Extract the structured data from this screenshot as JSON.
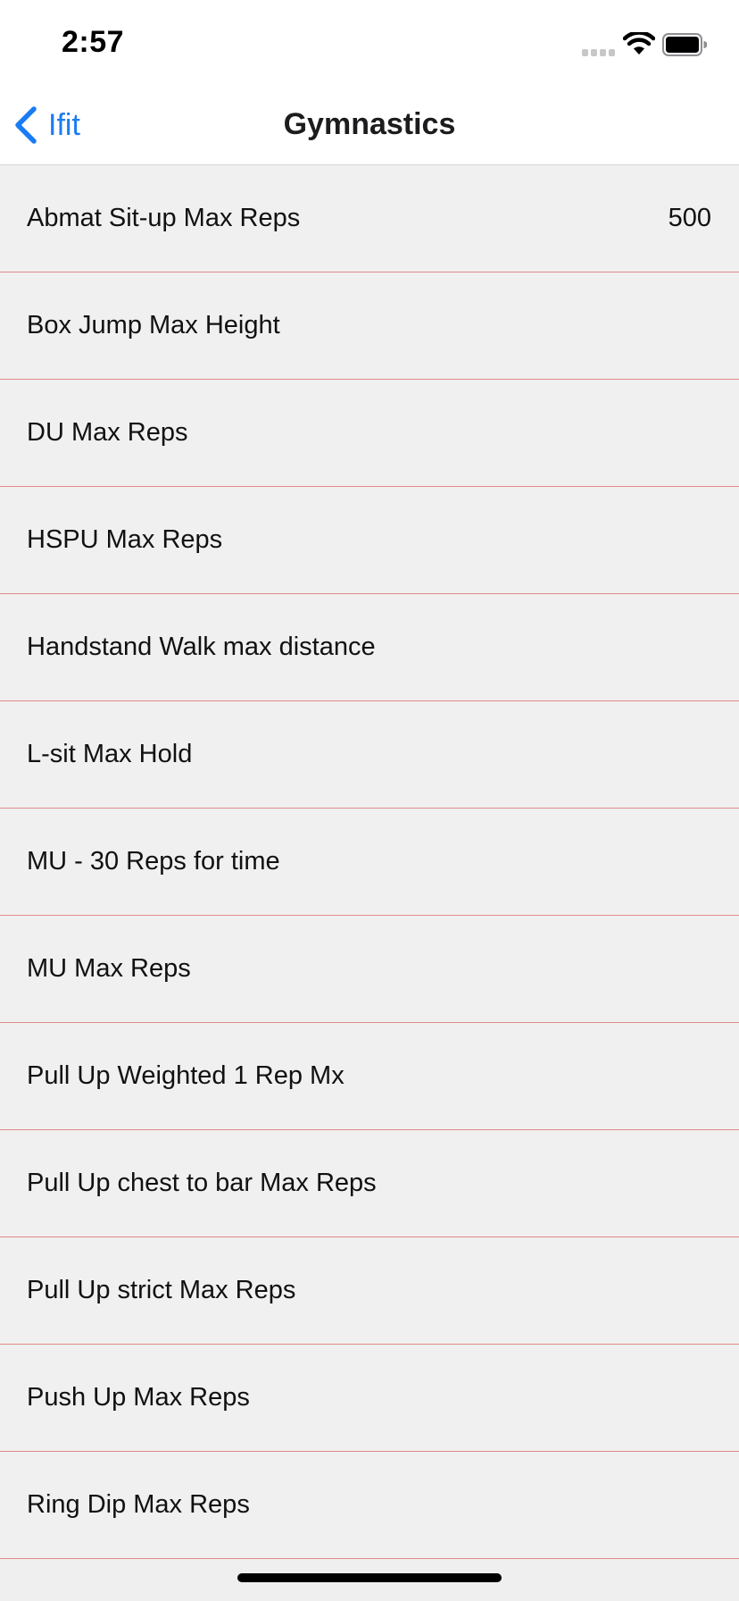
{
  "status": {
    "time": "2:57"
  },
  "nav": {
    "back_label": "Ifit",
    "title": "Gymnastics"
  },
  "rows": [
    {
      "label": "Abmat Sit-up Max Reps",
      "value": "500"
    },
    {
      "label": "Box Jump Max Height",
      "value": ""
    },
    {
      "label": "DU Max Reps",
      "value": ""
    },
    {
      "label": "HSPU Max Reps",
      "value": ""
    },
    {
      "label": "Handstand Walk max distance",
      "value": ""
    },
    {
      "label": "L-sit Max Hold",
      "value": ""
    },
    {
      "label": "MU - 30 Reps for time",
      "value": ""
    },
    {
      "label": "MU Max Reps",
      "value": ""
    },
    {
      "label": "Pull Up Weighted 1 Rep Mx",
      "value": ""
    },
    {
      "label": "Pull Up chest to bar Max Reps",
      "value": ""
    },
    {
      "label": "Pull Up strict Max Reps",
      "value": ""
    },
    {
      "label": "Push Up Max Reps",
      "value": ""
    },
    {
      "label": "Ring Dip Max Reps",
      "value": ""
    }
  ],
  "colors": {
    "accent": "#1a7cf5",
    "separator": "#e08b8b",
    "row_background": "#f0f0f0"
  }
}
